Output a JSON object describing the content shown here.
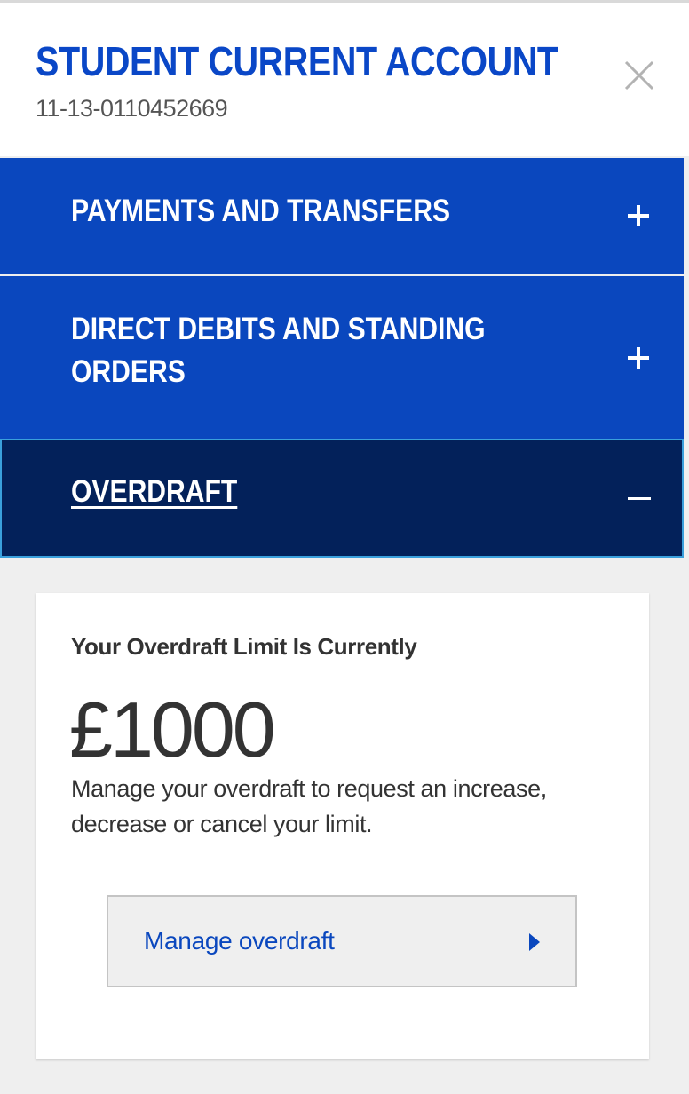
{
  "account": {
    "title": "STUDENT CURRENT ACCOUNT",
    "number": "11-13-0110452669"
  },
  "accordion": {
    "items": [
      {
        "label": "PAYMENTS AND TRANSFERS",
        "state": "collapsed",
        "icon": "plus-icon"
      },
      {
        "label": "DIRECT DEBITS AND STANDING ORDERS",
        "state": "collapsed",
        "icon": "plus-icon"
      },
      {
        "label": "OVERDRAFT",
        "state": "expanded",
        "icon": "minus-icon"
      }
    ]
  },
  "overdraft": {
    "heading": "Your Overdraft Limit Is Currently",
    "amount": "£1000",
    "description": "Manage your overdraft to request an increase, decrease or cancel your limit.",
    "manage_button_label": "Manage overdraft"
  },
  "colors": {
    "brand_blue": "#0a47be",
    "dark_navy": "#03215a",
    "focus_outline": "#3aa0dc",
    "background": "#efefef"
  }
}
